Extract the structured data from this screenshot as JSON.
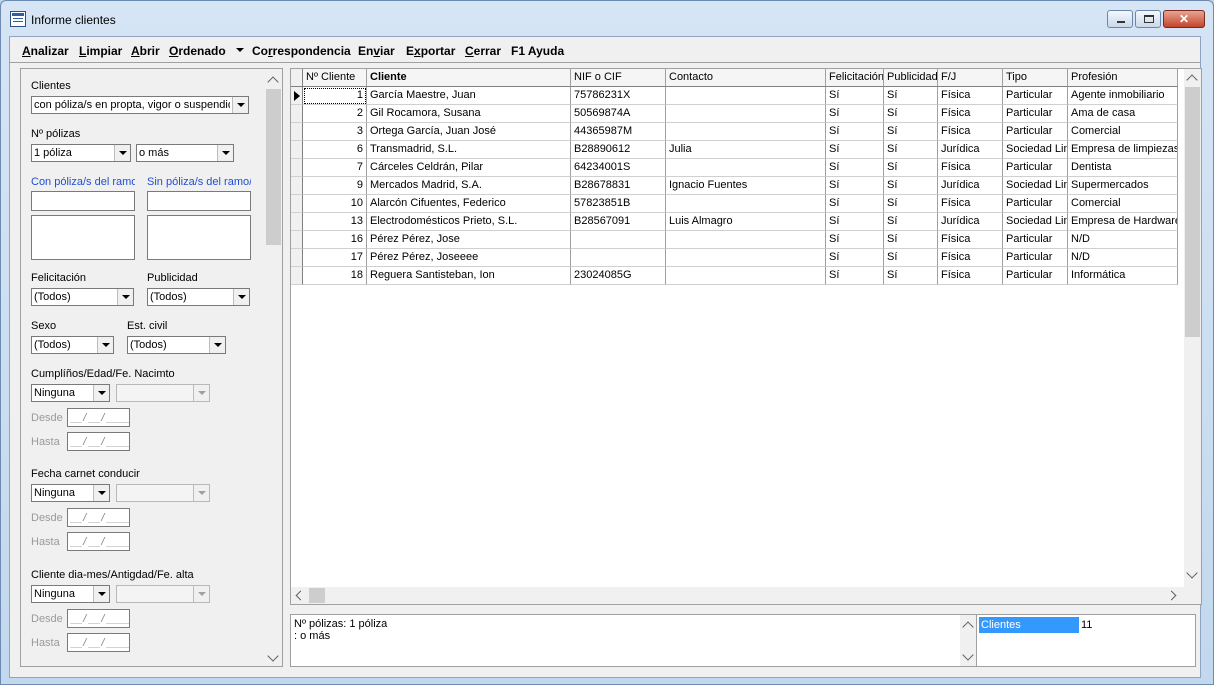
{
  "window": {
    "title": "Informe clientes",
    "close_glyph": "✕"
  },
  "menu": [
    {
      "pre": "",
      "ul": "A",
      "post": "nalizar"
    },
    {
      "pre": "",
      "ul": "L",
      "post": "impiar"
    },
    {
      "pre": "",
      "ul": "A",
      "post": "brir"
    },
    {
      "pre": "",
      "ul": "O",
      "post": "rdenado"
    },
    {
      "pre": "Co",
      "ul": "r",
      "post": "respondencia"
    },
    {
      "pre": "En",
      "ul": "v",
      "post": "iar"
    },
    {
      "pre": "E",
      "ul": "x",
      "post": "portar"
    },
    {
      "pre": "",
      "ul": "C",
      "post": "errar"
    },
    {
      "pre": "F1 Ayuda",
      "ul": "",
      "post": ""
    }
  ],
  "filters": {
    "clientes_label": "Clientes",
    "clientes_value": "con póliza/s en propta, vigor o suspendida",
    "npolizas_label": "Nº pólizas",
    "npolizas_value": "1 póliza",
    "npolizas_mode": "o más",
    "con_ramo_label": "Con póliza/s del ramo/s",
    "sin_ramo_label": "Sin póliza/s del ramo/s",
    "felicitacion_label": "Felicitación",
    "felicitacion_value": "(Todos)",
    "publicidad_label": "Publicidad",
    "publicidad_value": "(Todos)",
    "sexo_label": "Sexo",
    "sexo_value": "(Todos)",
    "estcivil_label": "Est. civil",
    "estcivil_value": "(Todos)",
    "cumple_label": "Cumplíños/Edad/Fe. Nacimto",
    "cumple_value": "Ninguna",
    "carnet_label": "Fecha carnet conducir",
    "carnet_value": "Ninguna",
    "alta_label": "Cliente dia-mes/Antigdad/Fe. alta",
    "alta_value": "Ninguna",
    "desde_label": "Desde",
    "hasta_label": "Hasta",
    "date_placeholder": "__/__/____"
  },
  "grid": {
    "columns": [
      "Nº Cliente",
      "Cliente",
      "NIF o CIF",
      "Contacto",
      "Felicitación",
      "Publicidad",
      "F/J",
      "Tipo",
      "Profesión"
    ],
    "rows": [
      [
        "1",
        "García Maestre, Juan",
        "75786231X",
        "",
        "Sí",
        "Sí",
        "Física",
        "Particular",
        "Agente inmobiliario"
      ],
      [
        "2",
        "Gil Rocamora, Susana",
        "50569874A",
        "",
        "Sí",
        "Sí",
        "Física",
        "Particular",
        "Ama de casa"
      ],
      [
        "3",
        "Ortega García, Juan José",
        "44365987M",
        "",
        "Sí",
        "Sí",
        "Física",
        "Particular",
        "Comercial"
      ],
      [
        "6",
        "Transmadrid, S.L.",
        "B28890612",
        "Julia",
        "Sí",
        "Sí",
        "Jurídica",
        "Sociedad Limitada",
        "Empresa de limpiezas."
      ],
      [
        "7",
        "Cárceles Celdrán, Pilar",
        "64234001S",
        "",
        "Sí",
        "Sí",
        "Física",
        "Particular",
        "Dentista"
      ],
      [
        "9",
        "Mercados Madrid, S.A.",
        "B28678831",
        "Ignacio Fuentes",
        "Sí",
        "Sí",
        "Jurídica",
        "Sociedad Limitada",
        "Supermercados"
      ],
      [
        "10",
        "Alarcón Cifuentes, Federico",
        "57823851B",
        "",
        "Sí",
        "Sí",
        "Física",
        "Particular",
        "Comercial"
      ],
      [
        "13",
        "Electrodomésticos Prieto, S.L.",
        "B28567091",
        "Luis Almagro",
        "Sí",
        "Sí",
        "Jurídica",
        "Sociedad Limitada",
        "Empresa de Hardware"
      ],
      [
        "16",
        "Pérez Pérez, Jose",
        "",
        "",
        "Sí",
        "Sí",
        "Física",
        "Particular",
        "N/D"
      ],
      [
        "17",
        "Pérez Pérez, Joseeee",
        "",
        "",
        "Sí",
        "Sí",
        "Física",
        "Particular",
        "N/D"
      ],
      [
        "18",
        "Reguera Santisteban, Ion",
        "23024085G",
        "",
        "Sí",
        "Sí",
        "Física",
        "Particular",
        "Informática"
      ]
    ]
  },
  "summary": {
    "line1": "Nº pólizas: 1 póliza",
    "line2": ": o más"
  },
  "stats": {
    "key": "Clientes",
    "value": "11"
  },
  "colors": {
    "selection": "#3399ff",
    "link_label": "#1f4fd6"
  }
}
